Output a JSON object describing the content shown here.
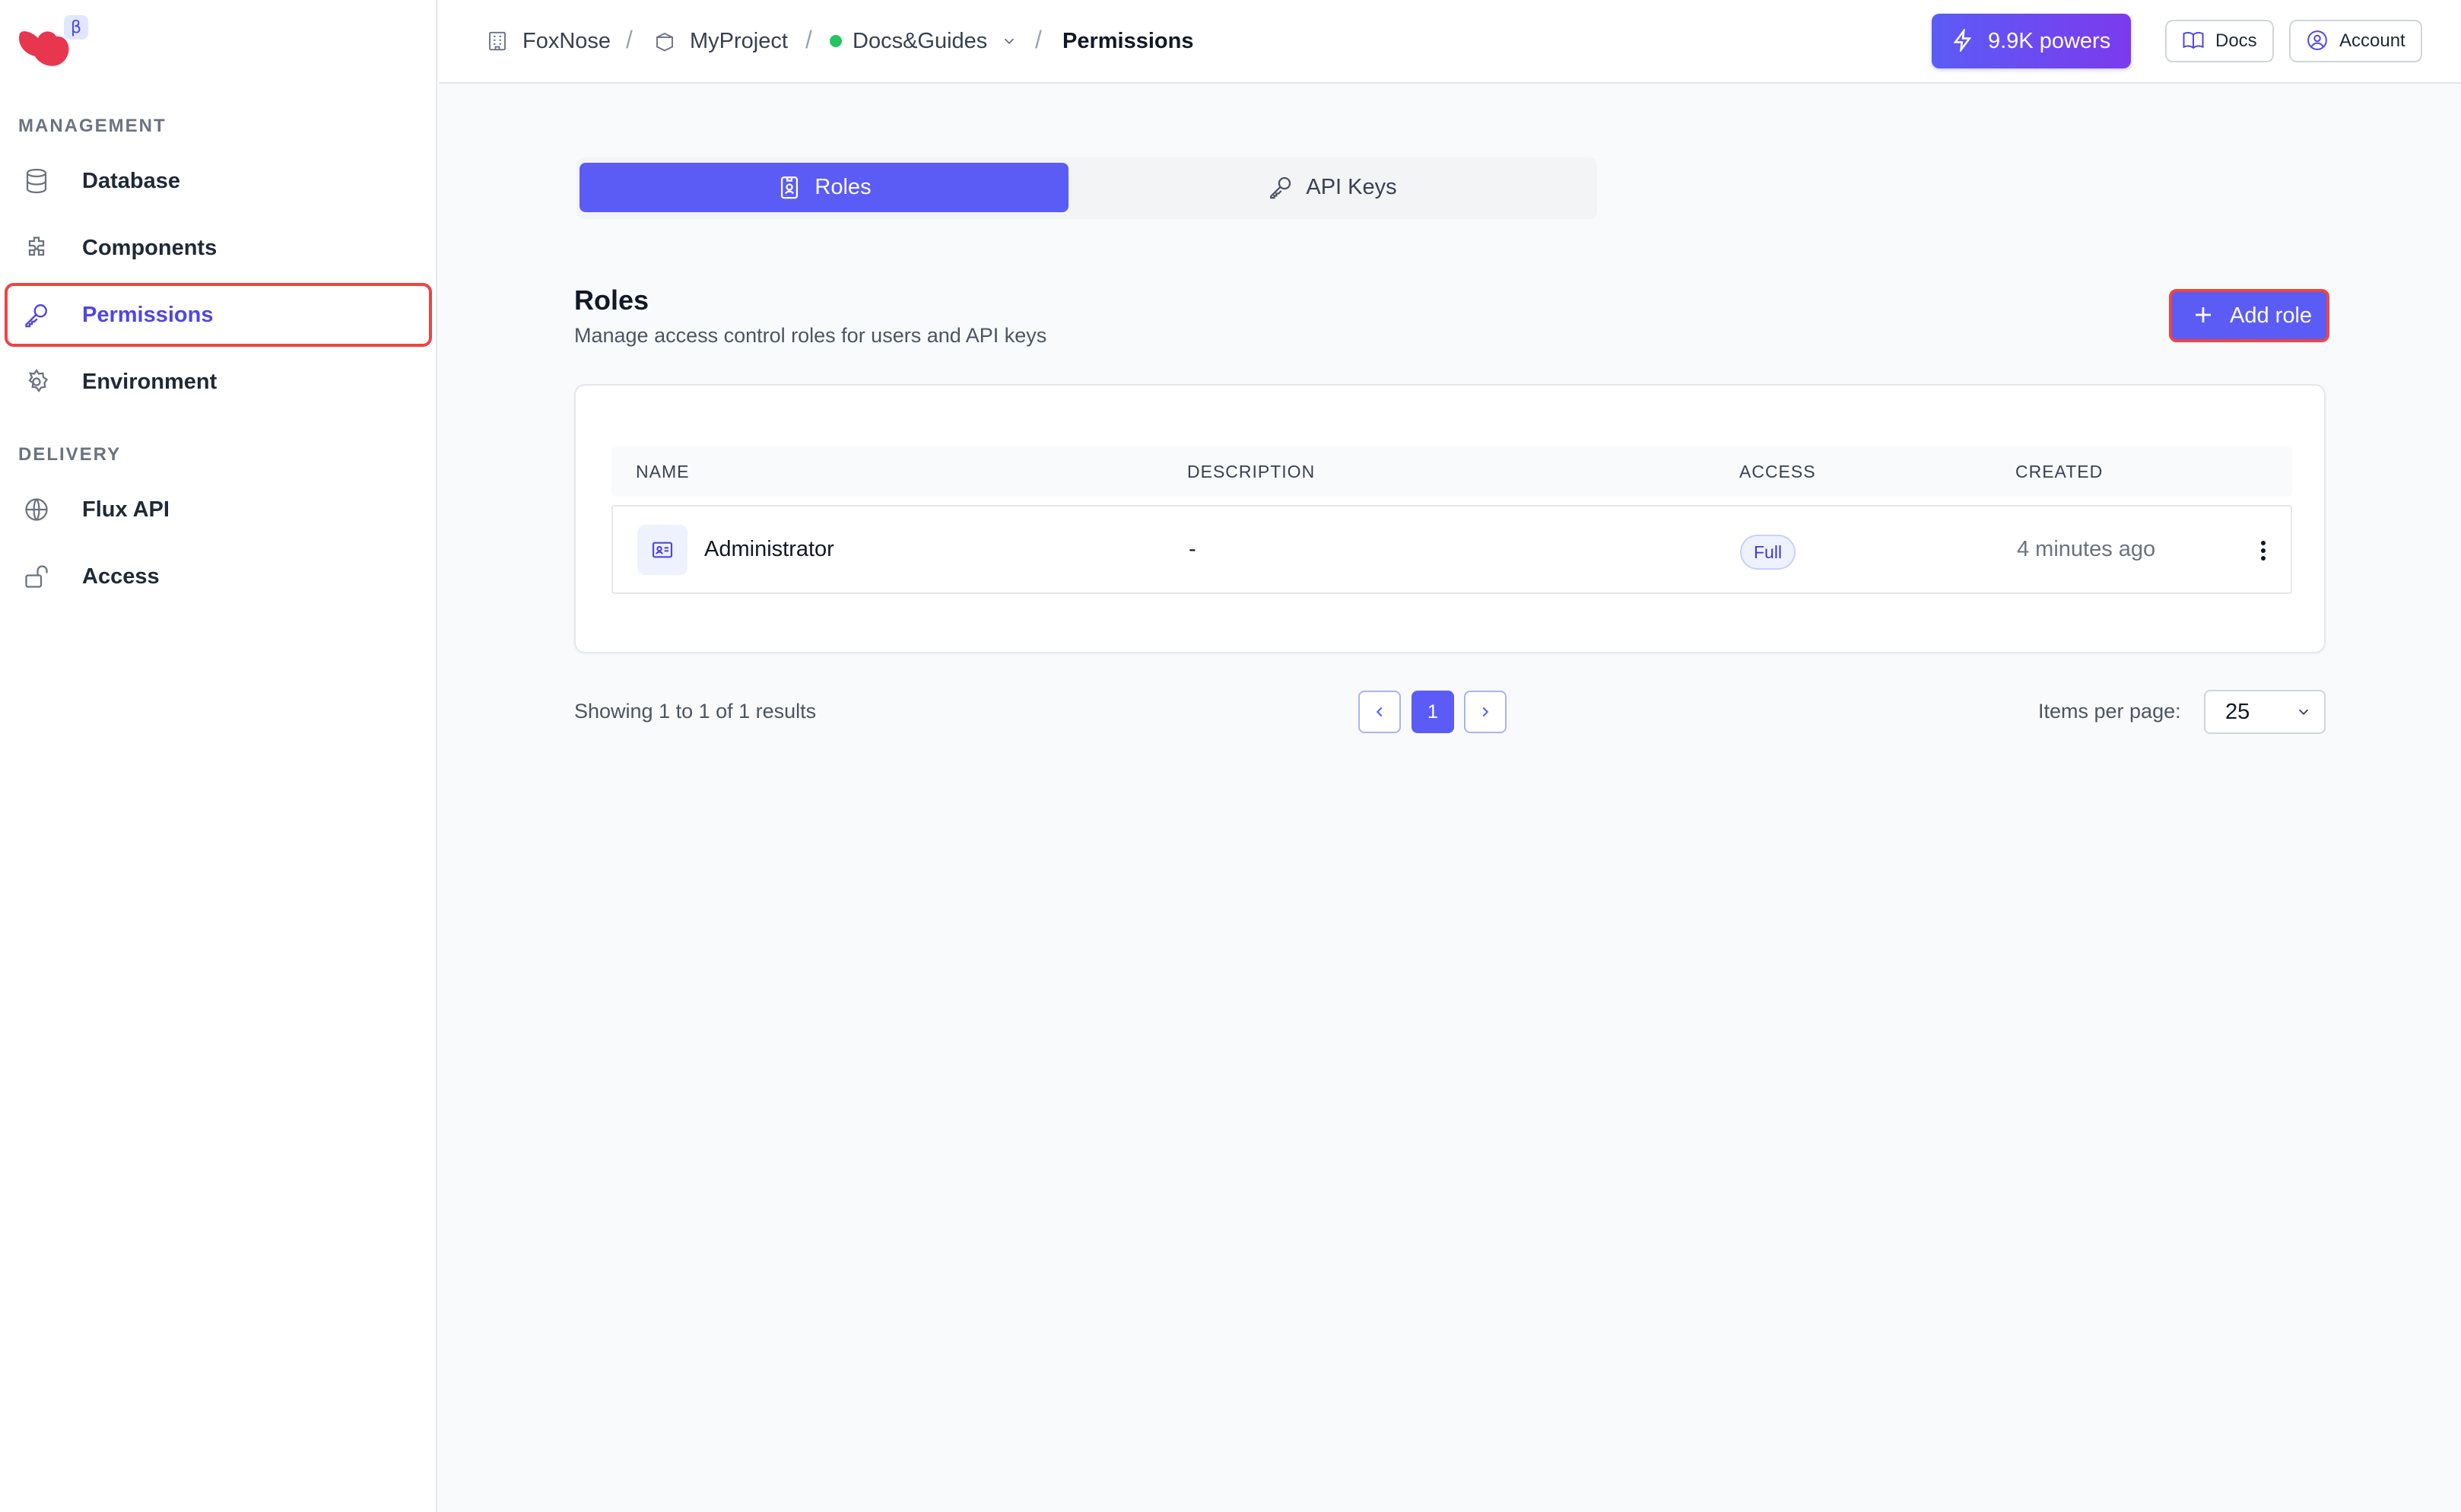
{
  "sidebar": {
    "beta_badge": "β",
    "sections": [
      {
        "title": "MANAGEMENT"
      },
      {
        "title": "DELIVERY"
      }
    ],
    "items": [
      {
        "label": "Database",
        "icon": "database-icon"
      },
      {
        "label": "Components",
        "icon": "puzzle-icon"
      },
      {
        "label": "Permissions",
        "icon": "key-icon",
        "active": true
      },
      {
        "label": "Environment",
        "icon": "gear-icon"
      },
      {
        "label": "Flux API",
        "icon": "globe-icon"
      },
      {
        "label": "Access",
        "icon": "unlock-icon"
      }
    ]
  },
  "header": {
    "breadcrumb": [
      {
        "label": "FoxNose",
        "icon": "building-icon"
      },
      {
        "label": "MyProject",
        "icon": "box-icon"
      },
      {
        "label": "Docs&Guides",
        "icon": "status-dot",
        "status_color": "#22c55e"
      },
      {
        "label": "Permissions"
      }
    ],
    "separator": "/",
    "powers_label": "9.9K powers",
    "docs_label": "Docs",
    "account_label": "Account"
  },
  "tabs": [
    {
      "label": "Roles",
      "icon": "id-badge-icon",
      "active": true
    },
    {
      "label": "API Keys",
      "icon": "key-icon",
      "active": false
    }
  ],
  "section": {
    "title": "Roles",
    "subtitle": "Manage access control roles for users and API keys",
    "add_button": "Add role"
  },
  "table": {
    "columns": [
      "NAME",
      "DESCRIPTION",
      "ACCESS",
      "CREATED"
    ],
    "rows": [
      {
        "name": "Administrator",
        "description": "-",
        "access": "Full",
        "created": "4 minutes ago"
      }
    ]
  },
  "pagination": {
    "showing": "Showing 1 to 1 of 1 results",
    "current_page": "1",
    "items_per_page_label": "Items per page:",
    "items_per_page_value": "25"
  },
  "colors": {
    "accent": "#5b5cf6",
    "highlight_outline": "#ef4444",
    "logo": "#e8364f"
  }
}
